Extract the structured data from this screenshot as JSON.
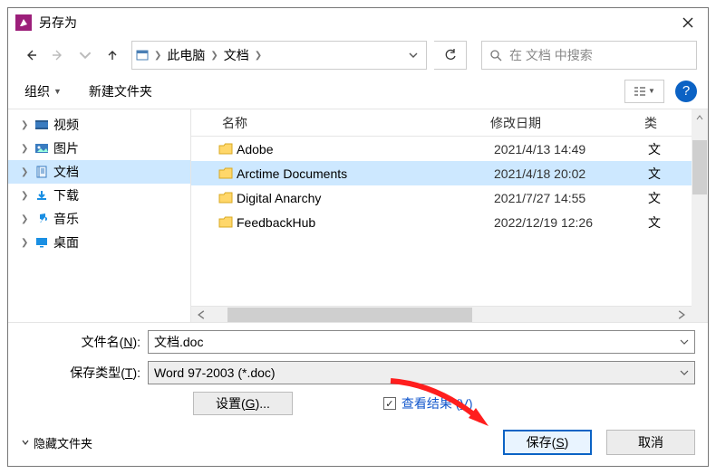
{
  "title": "另存为",
  "breadcrumb": {
    "root": "此电脑",
    "folder": "文档"
  },
  "search": {
    "placeholder": "在 文档 中搜索"
  },
  "toolbar": {
    "organize": "组织",
    "newfolder": "新建文件夹"
  },
  "sidebar": {
    "items": [
      {
        "label": "视频",
        "name": "sidebar-item-videos"
      },
      {
        "label": "图片",
        "name": "sidebar-item-pictures"
      },
      {
        "label": "文档",
        "name": "sidebar-item-documents",
        "selected": true
      },
      {
        "label": "下载",
        "name": "sidebar-item-downloads"
      },
      {
        "label": "音乐",
        "name": "sidebar-item-music"
      },
      {
        "label": "桌面",
        "name": "sidebar-item-desktop"
      }
    ]
  },
  "columns": {
    "name": "名称",
    "date": "修改日期",
    "type": "类"
  },
  "files": [
    {
      "name": "Adobe",
      "date": "2021/4/13 14:49",
      "type": "文"
    },
    {
      "name": "Arctime Documents",
      "date": "2021/4/18 20:02",
      "type": "文",
      "selected": true
    },
    {
      "name": "Digital Anarchy",
      "date": "2021/7/27 14:55",
      "type": "文"
    },
    {
      "name": "FeedbackHub",
      "date": "2022/12/19 12:26",
      "type": "文"
    }
  ],
  "form": {
    "filename_label_pre": "文件名(",
    "filename_label_u": "N",
    "filename_label_post": "):",
    "filename_value": "文档.doc",
    "filetype_label_pre": "保存类型(",
    "filetype_label_u": "T",
    "filetype_label_post": "):",
    "filetype_value": "Word 97-2003 (*.doc)",
    "settings_pre": "设置(",
    "settings_u": "G",
    "settings_post": ")...",
    "view_result_pre": "查看结果 (",
    "view_result_u": "V",
    "view_result_post": ")"
  },
  "footer": {
    "hide": "隐藏文件夹",
    "save_pre": "保存(",
    "save_u": "S",
    "save_post": ")",
    "cancel": "取消"
  },
  "icons": {
    "videos_color": "#2f6fb3",
    "pictures_color": "#2f6fb3",
    "docs_color": "#2f6fb3",
    "downloads_color": "#1a8fe3",
    "music_color": "#1a8fe3",
    "desktop_color": "#1a8fe3"
  }
}
